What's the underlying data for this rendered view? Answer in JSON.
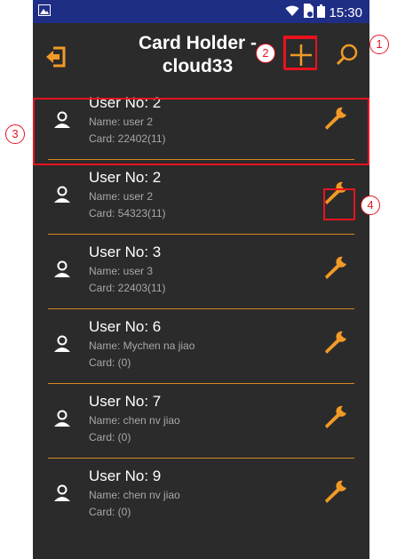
{
  "status": {
    "time": "15:30"
  },
  "appbar": {
    "title": "Card Holder - cloud33"
  },
  "colors": {
    "accent": "#f29a26",
    "status_bar": "#1f2e85",
    "background": "#2b2b2b",
    "callout": "#e8131f"
  },
  "icons": {
    "back": "exit-arrow-icon",
    "add": "plus-icon",
    "search": "magnifier-icon",
    "user": "user-icon",
    "edit": "wrench-icon"
  },
  "users": [
    {
      "user_no": "User No: 2",
      "name": "Name: user  2",
      "card": "Card: 22402(11)"
    },
    {
      "user_no": "User No: 2",
      "name": "Name: user  2",
      "card": "Card: 54323(11)"
    },
    {
      "user_no": "User No: 3",
      "name": "Name: user  3",
      "card": "Card: 22403(11)"
    },
    {
      "user_no": "User No: 6",
      "name": "Name: Mychen na jiao",
      "card": "Card: (0)"
    },
    {
      "user_no": "User No: 7",
      "name": "Name: chen nv jiao",
      "card": "Card: (0)"
    },
    {
      "user_no": "User No: 9",
      "name": "Name: chen nv jiao",
      "card": "Card: (0)"
    }
  ],
  "callouts": [
    "1",
    "2",
    "3",
    "4"
  ]
}
